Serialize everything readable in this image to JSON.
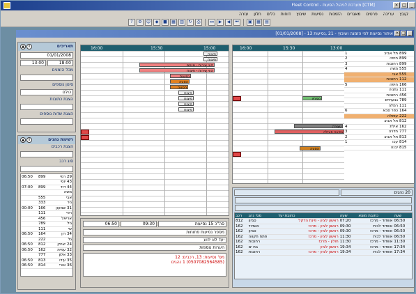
{
  "app": {
    "title": "[CTM] מערכת לניהול הסעות - Fleet Control",
    "window_title": "איתור נסיעות לפי הזמנה ושיבוץ - 21 ,נסיעות 13 - [01/01/2008]"
  },
  "menu": [
    "קובץ",
    "עריכה",
    "פרטים",
    "מאגרים",
    "הזמנות",
    "נסיעות",
    "שיבוץ",
    "דוחות",
    "כלים",
    "חלון",
    "עזרה"
  ],
  "left_panel": {
    "dates_title": "תאריכים",
    "date_value": "01/01/2008",
    "time_from": "18:00",
    "time_to": "13:00",
    "from_label": "מכל הזמנים",
    "filter_title": "סינון נוספים",
    "filter_value": "כולם",
    "lookup_title": "הצגת כתובות",
    "lookup2_title": "הצגת שדות נוספים",
    "rides_title": "רשימת נהגים",
    "rides_sub": "הצגת רכבים",
    "rides_sub2": "סוג רכב",
    "rows": [
      {
        "t": "06:50",
        "n": "899",
        "name": "29 רמי"
      },
      {
        "t": "",
        "n": "",
        "name": "43 יוסי"
      },
      {
        "t": "07:00",
        "n": "899",
        "name": "44 דוד"
      },
      {
        "t": "",
        "n": "",
        "name": "משה"
      },
      {
        "t": "",
        "n": "555",
        "name": "אבי"
      },
      {
        "t": "",
        "n": "333",
        "name": "ניר"
      },
      {
        "t": "00:00",
        "n": "166",
        "name": "31 שמעון"
      },
      {
        "t": "",
        "n": "111",
        "name": "רפי"
      },
      {
        "t": "",
        "n": "456",
        "name": "אריאל"
      },
      {
        "t": "",
        "n": "789",
        "name": "גיל"
      },
      {
        "t": "",
        "n": "111",
        "name": "שי"
      },
      {
        "t": "06:50",
        "n": "164",
        "name": "34 רון"
      },
      {
        "t": "",
        "n": "222",
        "name": "גל"
      },
      {
        "t": "06:50",
        "n": "812",
        "name": "24 יצחק"
      },
      {
        "t": "06:50",
        "n": "162",
        "name": "32 עמית"
      },
      {
        "t": "",
        "n": "777",
        "name": "33 אלון"
      },
      {
        "t": "06:50",
        "n": "813",
        "name": "35 עידו"
      },
      {
        "t": "06:50",
        "n": "814",
        "name": "36 אורי"
      }
    ]
  },
  "gantt_left": {
    "times": [
      "16:00",
      "15:30",
      "15:00"
    ],
    "bars": [
      {
        "label": "פיצוח",
        "color": "#f0f0f0"
      },
      {
        "label": "פיצוח",
        "color": "#f0f0f0"
      },
      {
        "label": "קווי שירות - מנחם",
        "color": "#f08080"
      },
      {
        "label": "קווי שירות - פיצוח",
        "color": "#f08080"
      },
      {
        "label": "נסיעות",
        "color": "#f08080"
      },
      {
        "label": "הסעה",
        "color": "#e08020"
      },
      {
        "label": "הסעה",
        "color": "#e08020"
      },
      {
        "label": "פיצוח",
        "color": "#f0f0f0"
      },
      {
        "label": "פיצוח",
        "color": "#f0f0f0"
      },
      {
        "label": "פיצוח",
        "color": "#f0f0f0"
      },
      {
        "label": "פיצוח",
        "color": "#f0f0f0"
      }
    ]
  },
  "gantt_right": {
    "times": [
      "16:00",
      "15:30",
      "13:00"
    ],
    "cols": [
      "#",
      "יעד",
      "מוצא"
    ],
    "rows": [
      {
        "n": "1",
        "dest": "תל אביב",
        "src": "899",
        "hl": false
      },
      {
        "n": "2",
        "dest": "חיפה",
        "src": "899",
        "hl": false
      },
      {
        "n": "3",
        "dest": "רחובות",
        "src": "899",
        "hl": false
      },
      {
        "n": "4",
        "dest": "משה",
        "src": "555",
        "hl": false
      },
      {
        "n": "",
        "dest": "אבי",
        "src": "555",
        "hl": true
      },
      {
        "n": "",
        "dest": "רחובות",
        "src": "112",
        "hl": true
      },
      {
        "n": "5",
        "dest": "חיפה",
        "src": "166",
        "hl": false
      },
      {
        "n": "",
        "dest": "נתניה",
        "src": "111",
        "hl": false
      },
      {
        "n": "",
        "dest": "רחובות",
        "src": "456",
        "hl": false
      },
      {
        "n": "",
        "dest": "גבעתיים",
        "src": "789",
        "hl": false
      },
      {
        "n": "",
        "dest": "רמלה",
        "src": "111",
        "hl": false
      },
      {
        "n": "6",
        "dest": "כפר סבא",
        "src": "164",
        "hl": false
      },
      {
        "n": "",
        "dest": "עפולה",
        "src": "222",
        "hl": true
      },
      {
        "n": "",
        "dest": "תל אביב",
        "src": "812",
        "hl": false
      },
      {
        "n": "4",
        "dest": "אילת",
        "src": "162",
        "hl": false
      },
      {
        "n": "3",
        "dest": "חדרה",
        "src": "777",
        "hl": false
      },
      {
        "n": "2",
        "dest": "תל אביב",
        "src": "813",
        "hl": false
      },
      {
        "n": "1",
        "dest": "עכו",
        "src": "814",
        "hl": false
      },
      {
        "n": "",
        "dest": "יבנה",
        "src": "815",
        "hl": false
      }
    ],
    "bar_labels": {
      "green": "ממתין",
      "dark": "עצירה",
      "red": "נסיעה פעילה",
      "orange": "הסעה"
    }
  },
  "bottom_left": {
    "fields": [
      "סה\"כ 15 נסיעות",
      "09:30",
      "06:50"
    ],
    "lines": [
      "מספר נסיעות פתוחות",
      "יעד לא ידוע",
      "הערות נוספות"
    ],
    "note": "מס' נסיעות: 13, רכבים: 12",
    "note2": "(0507082564585) 1 נהגים"
  },
  "bottom_right": {
    "title": "20 נהגים",
    "cols": [
      "רכב",
      "מס' נהג",
      "כתובת יעד",
      "שעה",
      "כתובת מוצא",
      "שעה"
    ],
    "rows": [
      [
        "812",
        "סביון",
        "ראשון לציון - פינת הדקל",
        "07:20",
        "אשדוד - מרכז",
        "06:50"
      ],
      [
        "162",
        "אשדוד",
        "ראשון לציון - מרכז",
        "09:30",
        "אשדוד לבית",
        "06:50"
      ],
      [
        "162",
        "סביון",
        "ראשון לציון - מרכז",
        "09:30",
        "אשדוד - מרכז",
        "06:50"
      ],
      [
        "162",
        "פתח תקווה",
        "ראשון לציון - מרכז",
        "11:30",
        "אשדוד לבית",
        "06:50"
      ],
      [
        "162",
        "רחובות",
        "חולון - מרכז",
        "11:30",
        "אשדוד - מרכז",
        "11:30"
      ],
      [
        "162",
        "בת ים",
        "ראשון לציון",
        "19:34",
        "אשדוד - מרכז",
        "17:34"
      ],
      [
        "162",
        "רחובות",
        "ראשון לציון - מרכז",
        "19:34",
        "אשדוד לבית",
        "17:34"
      ]
    ]
  }
}
